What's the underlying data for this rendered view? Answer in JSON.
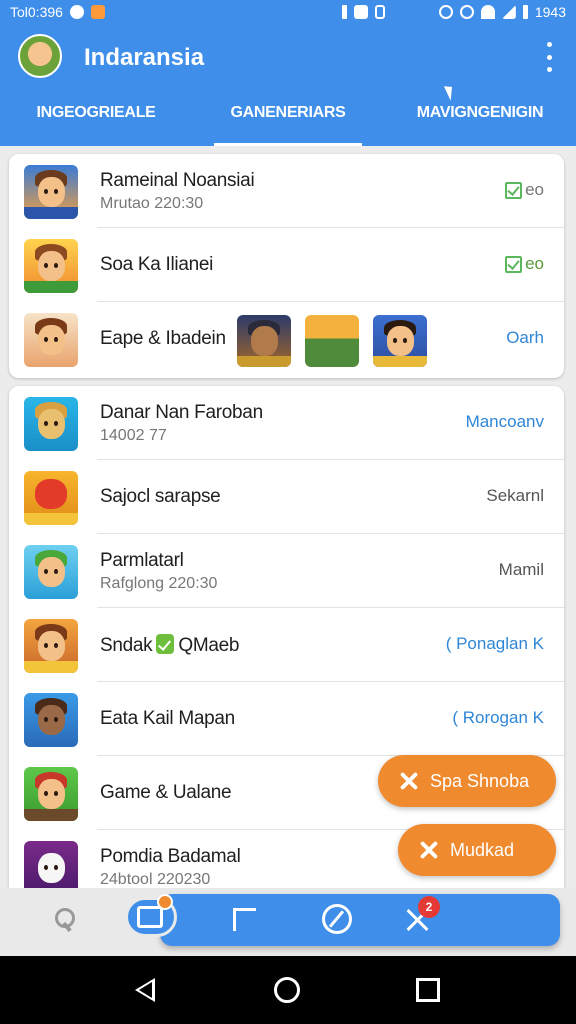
{
  "status_bar": {
    "left_text": "Tol0:396",
    "time": "1943"
  },
  "app": {
    "title": "Indaransia",
    "menu_icon": "more-vert-icon"
  },
  "tabs": [
    {
      "label": "INGEOGRIEALE",
      "active": false
    },
    {
      "label": "GANENERIARS",
      "active": true
    },
    {
      "label": "MAVIGNGENIGIN",
      "active": false
    }
  ],
  "card1": {
    "rows": [
      {
        "title": "Rameinal Noansiai",
        "subtitle": "Mrutao 220:30",
        "action": "eo",
        "action_style": "check"
      },
      {
        "title": "Soa Ka Ilianei",
        "action": "eo",
        "action_style": "check"
      },
      {
        "title": "Eape & Ibadein",
        "action": "Oarh",
        "action_style": "blue"
      }
    ]
  },
  "card2": {
    "rows": [
      {
        "title": "Danar Nan Faroban",
        "subtitle": "14002 77",
        "action": "Mancoanv",
        "action_style": "blue"
      },
      {
        "title": "Sajocl sarapse",
        "action": "Sekarnl",
        "action_style": "gray"
      },
      {
        "title": "Parmlatarl",
        "subtitle": "Rafglong 220:30",
        "action": "Mamil",
        "action_style": "gray"
      },
      {
        "title_pre": "Sndak",
        "title_post": "QMaeb",
        "action": "( Ponaglan K",
        "action_style": "blue"
      },
      {
        "title": "Eata Kail Mapan",
        "action": "( Rorogan K",
        "action_style": "blue"
      },
      {
        "title": "Game & Ualane"
      },
      {
        "title": "Pomdia Badamal",
        "subtitle": "24btool 220230"
      }
    ]
  },
  "fabs": [
    {
      "label": "Spa Shnoba"
    },
    {
      "label": "Mudkad"
    }
  ],
  "bottom_nav": {
    "badge": "2"
  },
  "colors": {
    "primary": "#3f8fea",
    "accent": "#f08a2f",
    "link": "#2f86d6"
  }
}
